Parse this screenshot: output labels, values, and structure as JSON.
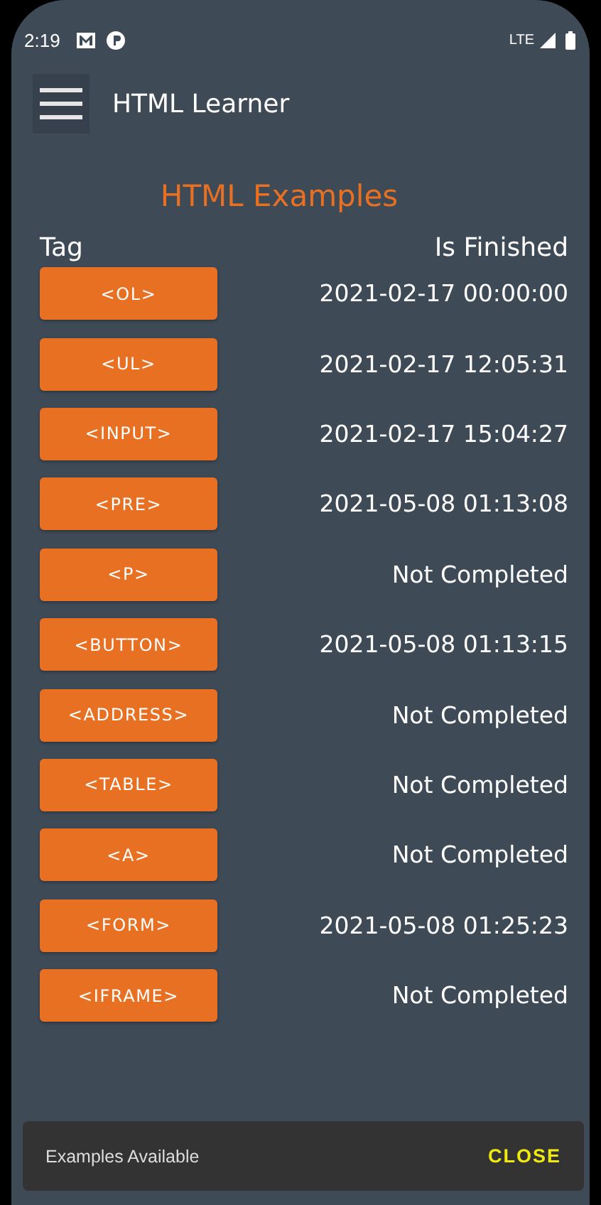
{
  "status_bar": {
    "time": "2:19",
    "network": "LTE"
  },
  "app_bar": {
    "title": "HTML Learner"
  },
  "heading": "HTML Examples",
  "table": {
    "columns": [
      "Tag",
      "Is Finished"
    ],
    "rows": [
      {
        "tag": "<OL>",
        "finished": "2021-02-17 00:00:00"
      },
      {
        "tag": "<UL>",
        "finished": "2021-02-17 12:05:31"
      },
      {
        "tag": "<INPUT>",
        "finished": "2021-02-17 15:04:27"
      },
      {
        "tag": "<PRE>",
        "finished": "2021-05-08 01:13:08"
      },
      {
        "tag": "<P>",
        "finished": "Not Completed"
      },
      {
        "tag": "<BUTTON>",
        "finished": "2021-05-08 01:13:15"
      },
      {
        "tag": "<ADDRESS>",
        "finished": "Not Completed"
      },
      {
        "tag": "<TABLE>",
        "finished": "Not Completed"
      },
      {
        "tag": "<A>",
        "finished": "Not Completed"
      },
      {
        "tag": "<FORM>",
        "finished": "2021-05-08 01:25:23"
      },
      {
        "tag": "<IFRAME>",
        "finished": "Not Completed"
      }
    ]
  },
  "snackbar": {
    "message": "Examples Available",
    "action": "CLOSE"
  }
}
